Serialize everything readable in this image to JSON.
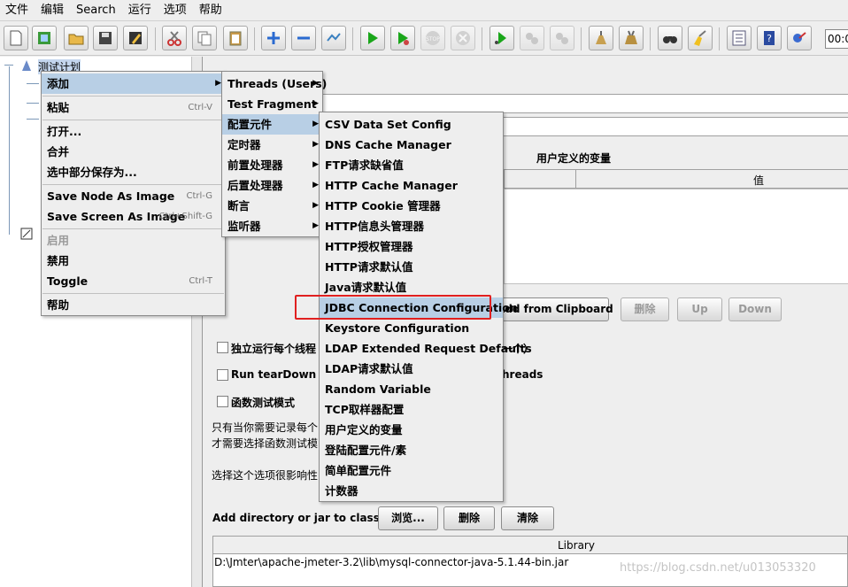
{
  "menubar": [
    "文件",
    "编辑",
    "Search",
    "运行",
    "选项",
    "帮助"
  ],
  "toolbar": {
    "timer": "00:0"
  },
  "tree": {
    "root": "测试计划"
  },
  "panel": {
    "udv_title": "用户定义的变量",
    "udv_col_name": "",
    "udv_col_value": "值",
    "add_clipboard": "Add from Clipboard",
    "delete": "删除",
    "up": "Up",
    "down": "Down",
    "cb1": "独立运行每个线程",
    "cb1_tail": "一个）",
    "cb2": "Run tearDown Thr",
    "cb2_tail": "hreads",
    "cb3": "函数测试模式",
    "note1": "只有当你需要记录每个",
    "note2": "才需要选择函数测试模",
    "note3": "选择这个选项很影响性",
    "classpath_label": "Add directory or jar to classpath",
    "browse": "浏览...",
    "remove": "删除",
    "clear": "清除",
    "library_header": "Library",
    "library_row": "D:\\Jmter\\apache-jmeter-3.2\\lib\\mysql-connector-java-5.1.44-bin.jar"
  },
  "ctx_menu": [
    {
      "label": "添加",
      "shortcut": "",
      "submenu": true,
      "selected": true,
      "disabled": false
    },
    {
      "label": "粘贴",
      "shortcut": "Ctrl-V",
      "submenu": false,
      "selected": false,
      "disabled": false
    },
    {
      "label": "打开...",
      "shortcut": "",
      "submenu": false,
      "selected": false,
      "disabled": false
    },
    {
      "label": "合并",
      "shortcut": "",
      "submenu": false,
      "selected": false,
      "disabled": false
    },
    {
      "label": "选中部分保存为...",
      "shortcut": "",
      "submenu": false,
      "selected": false,
      "disabled": false
    },
    {
      "label": "Save Node As Image",
      "shortcut": "Ctrl-G",
      "submenu": false,
      "selected": false,
      "disabled": false
    },
    {
      "label": "Save Screen As Image",
      "shortcut": "Ctrl+Shift-G",
      "submenu": false,
      "selected": false,
      "disabled": false
    },
    {
      "label": "启用",
      "shortcut": "",
      "submenu": false,
      "selected": false,
      "disabled": true
    },
    {
      "label": "禁用",
      "shortcut": "",
      "submenu": false,
      "selected": false,
      "disabled": false
    },
    {
      "label": "Toggle",
      "shortcut": "Ctrl-T",
      "submenu": false,
      "selected": false,
      "disabled": false
    },
    {
      "label": "帮助",
      "shortcut": "",
      "submenu": false,
      "selected": false,
      "disabled": false
    }
  ],
  "add_menu": [
    {
      "label": "Threads (Users)",
      "selected": false
    },
    {
      "label": "Test Fragment",
      "selected": false
    },
    {
      "label": "配置元件",
      "selected": true
    },
    {
      "label": "定时器",
      "selected": false
    },
    {
      "label": "前置处理器",
      "selected": false
    },
    {
      "label": "后置处理器",
      "selected": false
    },
    {
      "label": "断言",
      "selected": false
    },
    {
      "label": "监听器",
      "selected": false
    }
  ],
  "config_menu": [
    {
      "label": "CSV Data Set Config",
      "selected": false
    },
    {
      "label": "DNS Cache Manager",
      "selected": false
    },
    {
      "label": "FTP请求缺省值",
      "selected": false
    },
    {
      "label": "HTTP Cache Manager",
      "selected": false
    },
    {
      "label": "HTTP Cookie 管理器",
      "selected": false
    },
    {
      "label": "HTTP信息头管理器",
      "selected": false
    },
    {
      "label": "HTTP授权管理器",
      "selected": false
    },
    {
      "label": "HTTP请求默认值",
      "selected": false
    },
    {
      "label": "Java请求默认值",
      "selected": false
    },
    {
      "label": "JDBC Connection Configuration",
      "selected": true
    },
    {
      "label": "Keystore Configuration",
      "selected": false
    },
    {
      "label": "LDAP Extended Request Defaults",
      "selected": false
    },
    {
      "label": "LDAP请求默认值",
      "selected": false
    },
    {
      "label": "Random Variable",
      "selected": false
    },
    {
      "label": "TCP取样器配置",
      "selected": false
    },
    {
      "label": "用户定义的变量",
      "selected": false
    },
    {
      "label": "登陆配置元件/素",
      "selected": false
    },
    {
      "label": "简单配置元件",
      "selected": false
    },
    {
      "label": "计数器",
      "selected": false
    }
  ],
  "watermark": "https://blog.csdn.net/u013053320"
}
